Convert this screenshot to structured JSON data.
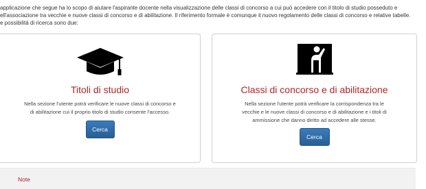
{
  "intro": {
    "line1": "applicazione che segue ha lo scopo di aiutare l'aspirante docente nella visualizzazione delle classi di concorso a cui può accedere con il titolo di studio posseduto e",
    "line2": "ell'associazione tra vecchie e nuove classi di concorso e di abilitazione. Il riferimento formale è comunque il nuovo regolamento delle classi di concorso e relative tabelle.",
    "line3": "e possibilità di ricerca sono due:"
  },
  "cards": [
    {
      "icon": "graduation-cap-icon",
      "title": "Titoli di studio",
      "desc_line1": "Nella sezione l'utente potrà verificare le nuove classi di concorso e",
      "desc_line2": "di abilitazione cui il proprio titolo di studio consente l'accesso.",
      "button": "Cerca"
    },
    {
      "icon": "teacher-blackboard-icon",
      "title": "Classi di concorso e di abilitazione",
      "desc_line1": "Nella sezione l'utente potrà verificare la corrispondenza tra le",
      "desc_line2": "vecchie e le nuove classi di concorso e di abilitazione e i titoli di",
      "desc_line3": "ammissione che danno diritto ad accedere alle stesse.",
      "button": "Cerca"
    }
  ],
  "note": {
    "label": "Note"
  },
  "colors": {
    "accent": "#b0232a",
    "button": "#2e6da4"
  }
}
